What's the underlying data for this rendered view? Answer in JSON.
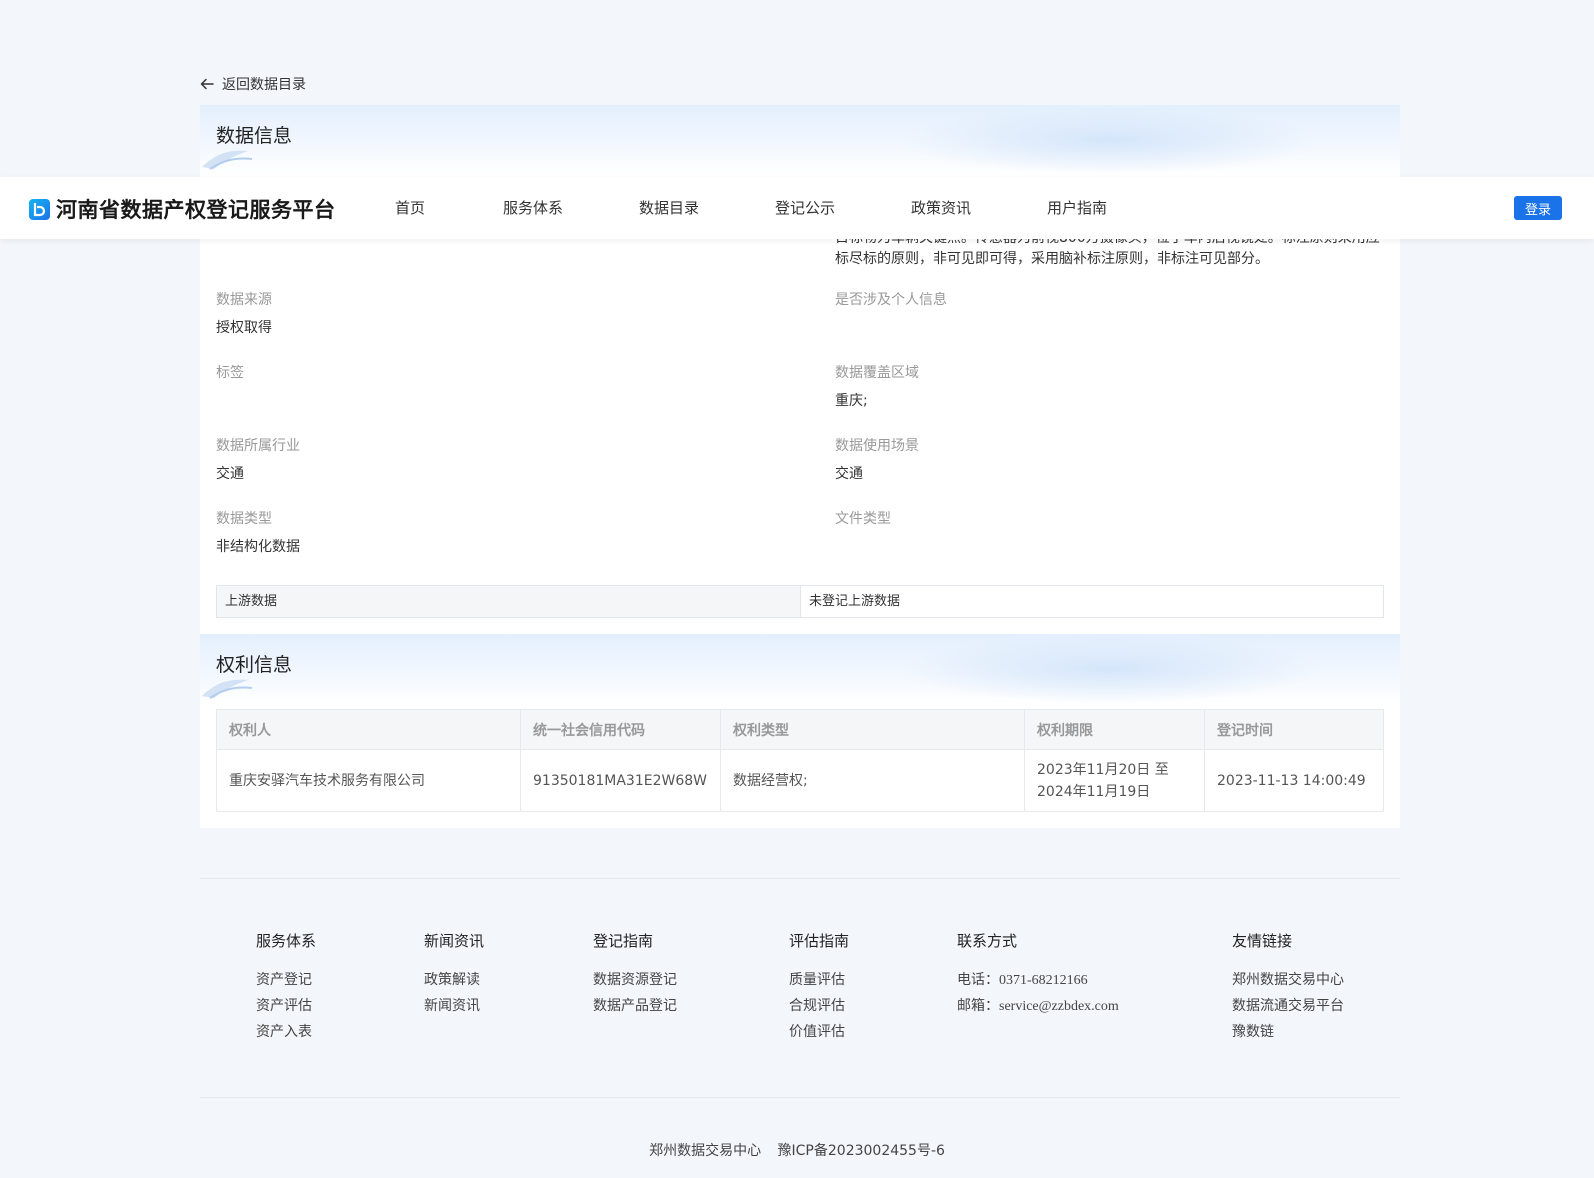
{
  "back": {
    "label": "返回数据目录"
  },
  "data_info": {
    "title": "数据信息",
    "description_tail_line1": "目标物为车辆关键点。传感器为前视800万摄像头，位于车内后视镜处。标注原则采用应",
    "description_tail_line2": "标尽标的原则，非可见即可得，采用脑补标注原则，非标注可见部分。",
    "fields": {
      "source": {
        "label": "数据来源",
        "value": "授权取得"
      },
      "personal_info": {
        "label": "是否涉及个人信息",
        "value": ""
      },
      "tags": {
        "label": "标签",
        "value": ""
      },
      "coverage": {
        "label": "数据覆盖区域",
        "value": "重庆;"
      },
      "industry": {
        "label": "数据所属行业",
        "value": "交通"
      },
      "scenario": {
        "label": "数据使用场景",
        "value": "交通"
      },
      "data_type": {
        "label": "数据类型",
        "value": "非结构化数据"
      },
      "file_type": {
        "label": "文件类型",
        "value": ""
      }
    },
    "upstream": {
      "label": "上游数据",
      "value": "未登记上游数据"
    }
  },
  "rights_info": {
    "title": "权利信息",
    "columns": [
      "权利人",
      "统一社会信用代码",
      "权利类型",
      "权利期限",
      "登记时间"
    ],
    "rows": [
      {
        "holder": "重庆安驿汽车技术服务有限公司",
        "credit_code": "91350181MA31E2W68W",
        "right_type": "数据经营权;",
        "term_line1": "2023年11月20日 至",
        "term_line2": "2024年11月19日",
        "registered_at": "2023-11-13 14:00:49"
      }
    ]
  },
  "navbar": {
    "brand": "河南省数据产权登记服务平台",
    "items": [
      "首页",
      "服务体系",
      "数据目录",
      "登记公示",
      "政策资讯",
      "用户指南"
    ],
    "login": "登录",
    "accent": "#1a73e8"
  },
  "footer": {
    "columns": [
      {
        "heading": "服务体系",
        "links": [
          "资产登记",
          "资产评估",
          "资产入表"
        ]
      },
      {
        "heading": "新闻资讯",
        "links": [
          "政策解读",
          "新闻资讯"
        ]
      },
      {
        "heading": "登记指南",
        "links": [
          "数据资源登记",
          "数据产品登记"
        ]
      },
      {
        "heading": "评估指南",
        "links": [
          "质量评估",
          "合规评估",
          "价值评估"
        ]
      },
      {
        "heading": "友情链接",
        "links": [
          "郑州数据交易中心",
          "数据流通交易平台",
          "豫数链"
        ]
      }
    ],
    "contact": {
      "heading": "联系方式",
      "phone_label": "电话：",
      "phone": "0371-68212166",
      "email_label": "邮箱：",
      "email": "service@zzbdex.com"
    },
    "copyright": {
      "org": "郑州数据交易中心",
      "icp": "豫ICP备2023002455号-6"
    }
  }
}
